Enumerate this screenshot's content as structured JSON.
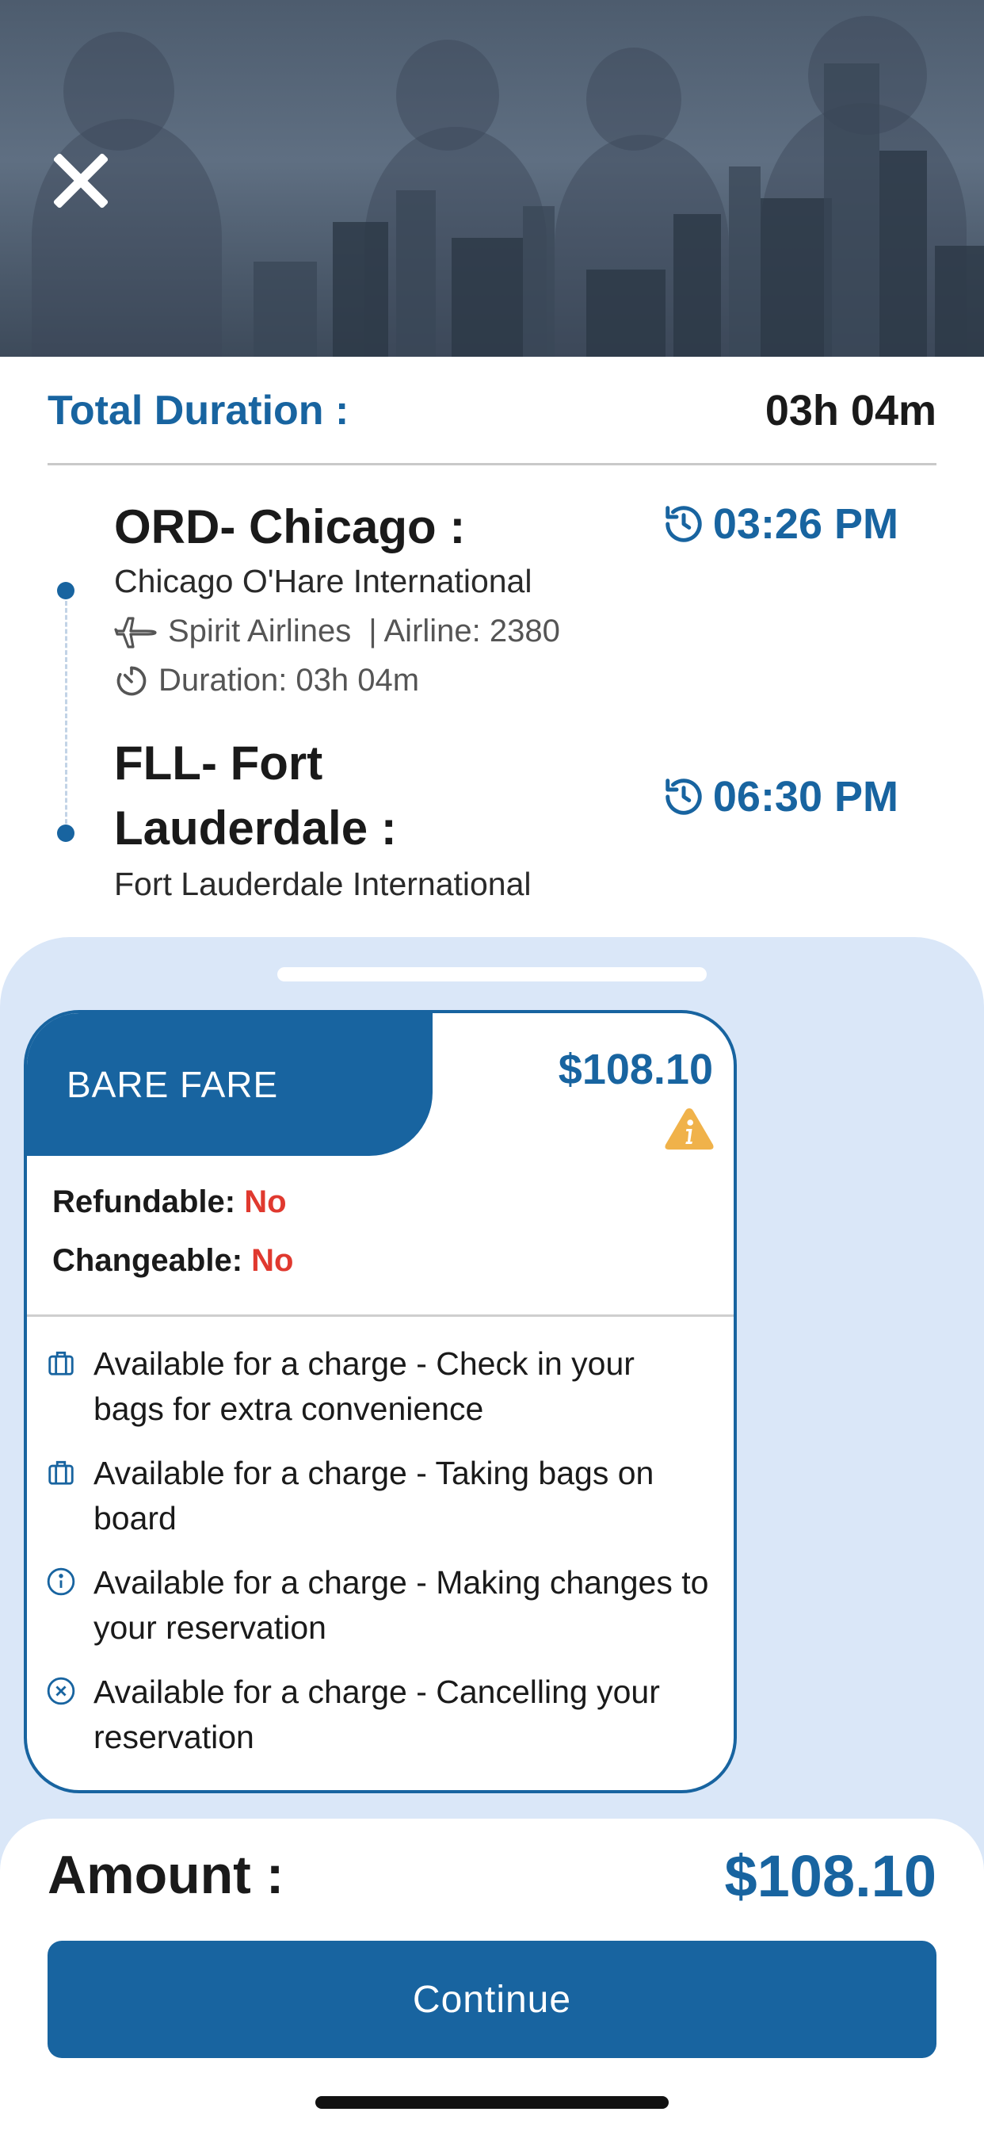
{
  "header": {
    "close_icon": "close-icon"
  },
  "summary": {
    "total_duration_label": "Total Duration :",
    "total_duration_value": "03h 04m"
  },
  "itinerary": {
    "departure": {
      "city": "ORD- Chicago :",
      "airport": "Chicago O'Hare International",
      "time": "03:26 PM",
      "time_icon": "clock-history-icon"
    },
    "flight": {
      "airline_icon": "airplane-icon",
      "airline": "Spirit Airlines",
      "flight_number": "| Airline: 2380",
      "duration_icon": "timer-icon",
      "duration": "Duration: 03h 04m"
    },
    "arrival": {
      "city_line1": "FLL- Fort",
      "city_line2": "Lauderdale :",
      "airport": "Fort Lauderdale International",
      "time": "06:30 PM",
      "time_icon": "clock-history-icon"
    }
  },
  "fare": {
    "name": "BARE FARE",
    "price": "$108.10",
    "warning_icon": "warning-icon",
    "refundable_label": "Refundable:",
    "refundable_value": "No",
    "changeable_label": "Changeable:",
    "changeable_value": "No",
    "features": [
      {
        "icon": "luggage-icon",
        "text": "Available for a charge - Check in your bags for extra convenience"
      },
      {
        "icon": "luggage-icon",
        "text": "Available for a charge - Taking bags on board"
      },
      {
        "icon": "info-icon",
        "text": "Available for a charge - Making changes to your reservation"
      },
      {
        "icon": "cancel-circle-icon",
        "text": "Available for a charge - Cancelling your reservation"
      }
    ]
  },
  "footer": {
    "amount_label": "Amount :",
    "amount_value": "$108.10",
    "continue_label": "Continue"
  },
  "colors": {
    "primary": "#1864a0",
    "negative": "#e0392f",
    "warning": "#f0b24a",
    "fare_background": "#dae7f8"
  }
}
